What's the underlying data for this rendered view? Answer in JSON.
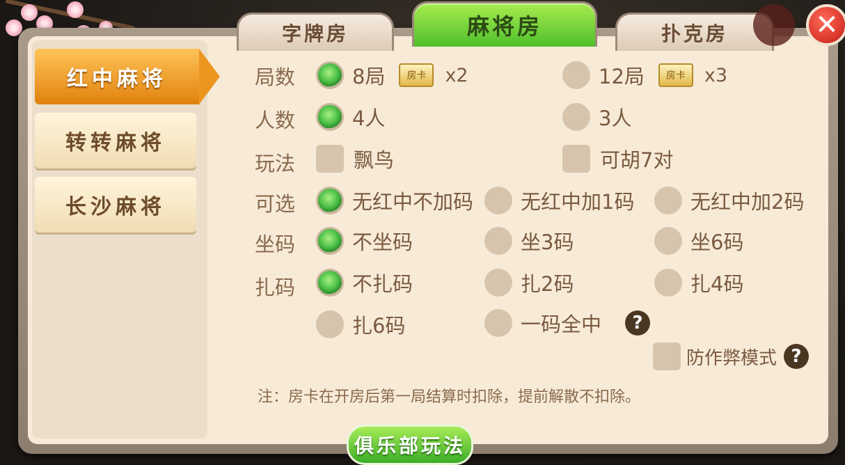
{
  "tabs": [
    {
      "label": "字牌房",
      "active": false
    },
    {
      "label": "麻将房",
      "active": true
    },
    {
      "label": "扑克房",
      "active": false
    }
  ],
  "close_label": "✕",
  "sidebar": {
    "items": [
      {
        "label": "红中麻将",
        "active": true
      },
      {
        "label": "转转麻将",
        "active": false
      },
      {
        "label": "长沙麻将",
        "active": false
      }
    ]
  },
  "options": {
    "rounds": {
      "label": "局数",
      "choices": [
        {
          "text": "8局",
          "card": "房卡",
          "mult": "x2",
          "selected": true
        },
        {
          "text": "12局",
          "card": "房卡",
          "mult": "x3",
          "selected": false
        }
      ]
    },
    "players": {
      "label": "人数",
      "choices": [
        {
          "text": "4人",
          "selected": true
        },
        {
          "text": "3人",
          "selected": false
        }
      ]
    },
    "play": {
      "label": "玩法",
      "choices": [
        {
          "text": "飘鸟",
          "checked": false
        },
        {
          "text": "可胡7对",
          "checked": false
        }
      ]
    },
    "optional": {
      "label": "可选",
      "choices": [
        {
          "text": "无红中不加码",
          "selected": true
        },
        {
          "text": "无红中加1码",
          "selected": false
        },
        {
          "text": "无红中加2码",
          "selected": false
        }
      ]
    },
    "sit_code": {
      "label": "坐码",
      "choices": [
        {
          "text": "不坐码",
          "selected": true
        },
        {
          "text": "坐3码",
          "selected": false
        },
        {
          "text": "坐6码",
          "selected": false
        }
      ]
    },
    "zha_code": {
      "label": "扎码",
      "choices": [
        {
          "text": "不扎码",
          "selected": true
        },
        {
          "text": "扎2码",
          "selected": false
        },
        {
          "text": "扎4码",
          "selected": false
        },
        {
          "text": "扎6码",
          "selected": false
        },
        {
          "text": "一码全中",
          "selected": false
        }
      ]
    },
    "anti_cheat": {
      "text": "防作弊模式",
      "checked": false
    }
  },
  "help_label": "?",
  "note": "注：房卡在开房后第一局结算时扣除，提前解散不扣除。",
  "club_button": "俱乐部玩法"
}
